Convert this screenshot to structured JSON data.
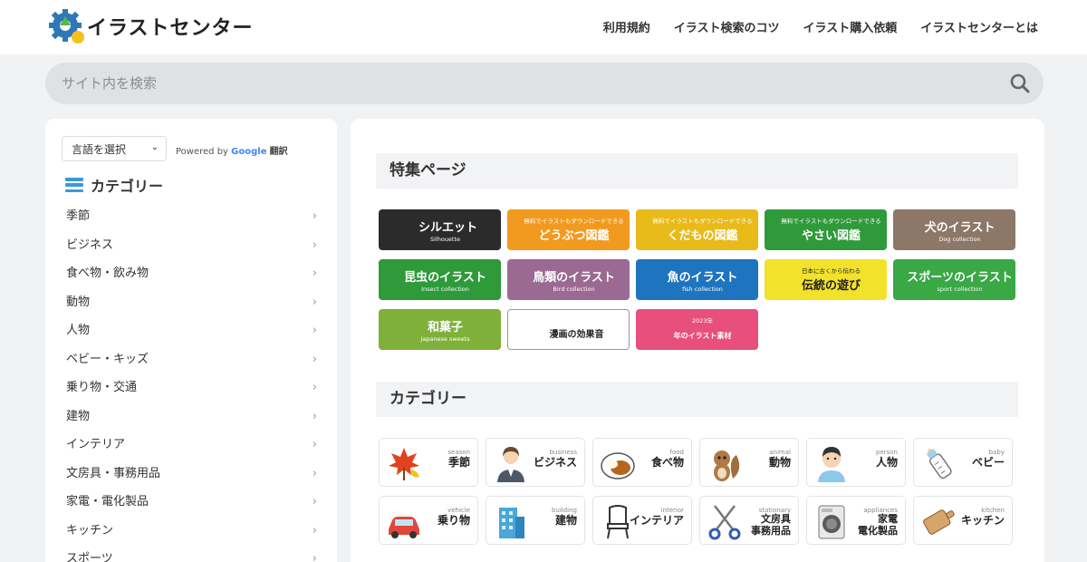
{
  "header": {
    "logo_text": "イラストセンター",
    "nav": [
      "利用規約",
      "イラスト検索のコツ",
      "イラスト購入依頼",
      "イラストセンターとは"
    ]
  },
  "search": {
    "placeholder": "サイト内を検索",
    "icon": "search-icon"
  },
  "sidebar": {
    "language_select": "言語を選択",
    "powered_by": "Powered by",
    "google": "Google",
    "translate": "翻訳",
    "category_heading": "カテゴリー",
    "items": [
      "季節",
      "ビジネス",
      "食べ物・飲み物",
      "動物",
      "人物",
      "ベビー・キッズ",
      "乗り物・交通",
      "建物",
      "インテリア",
      "文房具・事務用品",
      "家電・電化製品",
      "キッチン",
      "スポーツ"
    ]
  },
  "main": {
    "featured_title": "特集ページ",
    "category_title": "カテゴリー",
    "banners": [
      {
        "title": "シルエット",
        "sub": "Silhouette",
        "bg": "#2b2b2b"
      },
      {
        "title": "どうぶつ図鑑",
        "sub": "無料でイラストもダウンロードできる",
        "bg": "#f29a1f"
      },
      {
        "title": "くだもの図鑑",
        "sub": "無料でイラストもダウンロードできる",
        "bg": "#e8ba1a"
      },
      {
        "title": "やさい図鑑",
        "sub": "無料でイラストもダウンロードできる",
        "bg": "#2f9a3a"
      },
      {
        "title": "犬のイラスト",
        "sub": "Dog collection",
        "bg": "#8d7767"
      },
      {
        "title": "昆虫のイラスト",
        "sub": "Insect collection",
        "bg": "#2f9a3a"
      },
      {
        "title": "鳥類のイラスト",
        "sub": "Bird collection",
        "bg": "#9b6a93"
      },
      {
        "title": "魚のイラスト",
        "sub": "fish collection",
        "bg": "#1f74bf"
      },
      {
        "title": "伝統の遊び",
        "sub": "日本に古くから伝わる",
        "bg": "#f3e22c"
      },
      {
        "title": "スポーツのイラスト",
        "sub": "sport collection",
        "bg": "#39a845"
      },
      {
        "title": "和菓子",
        "sub": "Japanese sweets",
        "bg": "#7fb03a"
      },
      {
        "title": "漫画の効果音",
        "sub": "",
        "bg": "#ffffff"
      },
      {
        "title": "年のイラスト素材",
        "sub": "2023年",
        "bg": "#e84f7c"
      }
    ],
    "categories": [
      {
        "en": "season",
        "jp": "季節",
        "icon": "maple-leaf-icon"
      },
      {
        "en": "business",
        "jp": "ビジネス",
        "icon": "businesswoman-icon"
      },
      {
        "en": "food",
        "jp": "食べ物",
        "icon": "curry-icon"
      },
      {
        "en": "animal",
        "jp": "動物",
        "icon": "squirrel-icon"
      },
      {
        "en": "person",
        "jp": "人物",
        "icon": "boy-icon"
      },
      {
        "en": "baby",
        "jp": "ベビー",
        "icon": "baby-bottle-icon"
      },
      {
        "en": "vehicle",
        "jp": "乗り物",
        "icon": "car-icon"
      },
      {
        "en": "building",
        "jp": "建物",
        "icon": "building-icon"
      },
      {
        "en": "interior",
        "jp": "インテリア",
        "icon": "chair-icon"
      },
      {
        "en": "stationary",
        "jp": "文房具\n事務用品",
        "icon": "scissors-icon"
      },
      {
        "en": "appliances",
        "jp": "家電\n電化製品",
        "icon": "washing-machine-icon"
      },
      {
        "en": "kitchen",
        "jp": "キッチン",
        "icon": "cutting-board-icon"
      }
    ]
  }
}
